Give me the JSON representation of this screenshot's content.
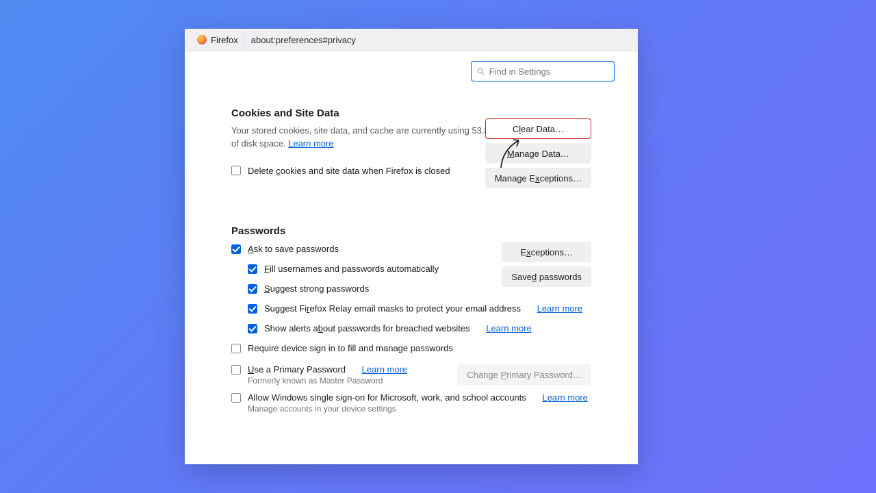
{
  "titlebar": {
    "app_name": "Firefox",
    "url": "about:preferences#privacy"
  },
  "search": {
    "placeholder": "Find in Settings"
  },
  "cookies": {
    "heading": "Cookies and Site Data",
    "desc_part1": "Your stored cookies, site data, and cache are currently using 53.8 MB of disk space. ",
    "learn_more": "Learn more",
    "delete_on_close": "Delete cookies and site data when Firefox is closed",
    "clear_data": "Clear Data…",
    "manage_data": "Manage Data…",
    "manage_exceptions": "Manage Exceptions…"
  },
  "passwords": {
    "heading": "Passwords",
    "ask_save": "Ask to save passwords",
    "fill_auto": "Fill usernames and passwords automatically",
    "suggest_strong": "Suggest strong passwords",
    "relay": "Suggest Firefox Relay email masks to protect your email address",
    "relay_learn": "Learn more",
    "alerts": "Show alerts about passwords for breached websites",
    "alerts_learn": "Learn more",
    "device_signin": "Require device sign in to fill and manage passwords",
    "primary_pwd": "Use a Primary Password",
    "primary_learn": "Learn more",
    "formerly": "Formerly known as Master Password",
    "change_primary": "Change Primary Password…",
    "windows_sso": "Allow Windows single sign-on for Microsoft, work, and school accounts",
    "sso_learn": "Learn more",
    "sso_sub": "Manage accounts in your device settings",
    "exceptions": "Exceptions…",
    "saved": "Saved passwords"
  }
}
